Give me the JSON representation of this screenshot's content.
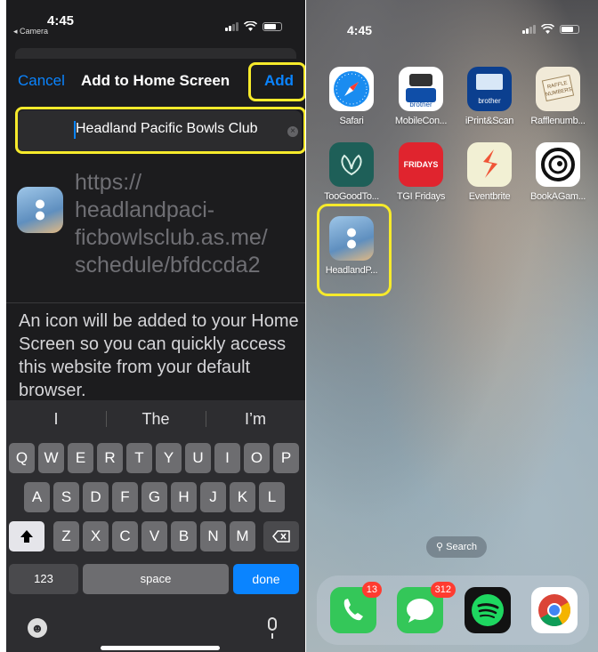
{
  "left": {
    "status": {
      "time": "4:45",
      "back_app": "◂ Camera"
    },
    "nav": {
      "cancel": "Cancel",
      "title": "Add to Home Screen",
      "add": "Add"
    },
    "name_field": {
      "value": "Headland Pacific Bowls Club",
      "clear_icon": "clear-circle-icon"
    },
    "url_lines": [
      "https://",
      "headlandpaci-",
      "ficbowlsclub.as.me/",
      "schedule/bfdccda2"
    ],
    "description": "An icon will be added to your Home Screen so you can quickly access this website from your default browser.",
    "keyboard": {
      "suggestions": [
        "I",
        "The",
        "I’m"
      ],
      "row1": [
        "Q",
        "W",
        "E",
        "R",
        "T",
        "Y",
        "U",
        "I",
        "O",
        "P"
      ],
      "row2": [
        "A",
        "S",
        "D",
        "F",
        "G",
        "H",
        "J",
        "K",
        "L"
      ],
      "row3": [
        "Z",
        "X",
        "C",
        "V",
        "B",
        "N",
        "M"
      ],
      "numbers": "123",
      "space": "space",
      "done": "done"
    },
    "highlight_color": "#f6ea2b",
    "accent_color": "#0a84ff"
  },
  "right": {
    "status": {
      "time": "4:45"
    },
    "apps": [
      {
        "label": "Safari"
      },
      {
        "label": "MobileCon..."
      },
      {
        "label": "iPrint&Scan"
      },
      {
        "label": "Rafflenumb..."
      },
      {
        "label": "TooGoodTo..."
      },
      {
        "label": "TGI Fridays"
      },
      {
        "label": "Eventbrite"
      },
      {
        "label": "BookAGam..."
      },
      {
        "label": "HeadlandP..."
      }
    ],
    "icon_text": {
      "brother": "brother",
      "tgi": "FRIDAYS",
      "raffle": "RAFFLE NUMBERS"
    },
    "search": "Search",
    "dock_badges": {
      "phone": "13",
      "messages": "312"
    }
  }
}
